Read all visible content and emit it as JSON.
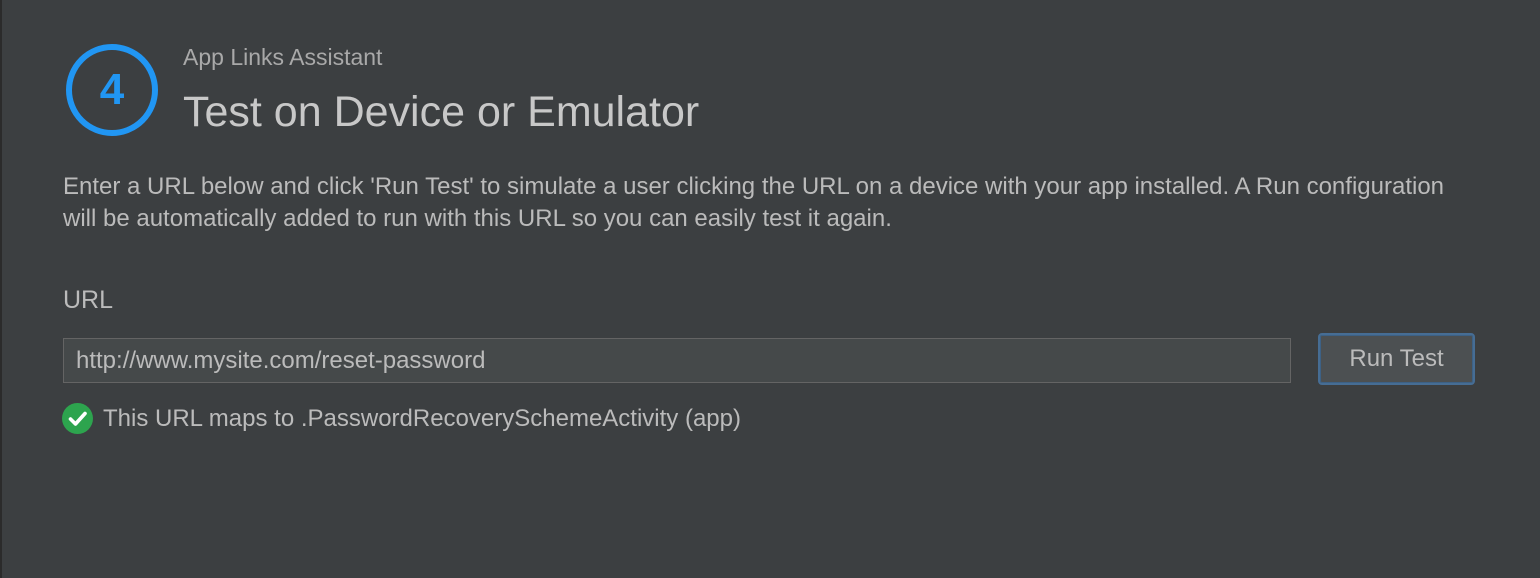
{
  "header": {
    "step_number": "4",
    "assistant_name": "App Links Assistant",
    "title": "Test on Device or Emulator"
  },
  "description": "Enter a URL below and click 'Run Test' to simulate a user clicking the URL on a device with your app installed. A Run configuration will be automatically added to run with this URL so you can easily test it again.",
  "url_field": {
    "label": "URL",
    "value": "http://www.mysite.com/reset-password"
  },
  "run_button": {
    "label": "Run Test"
  },
  "result": {
    "icon": "check-circle-icon",
    "status": "success",
    "text": "This URL maps to .PasswordRecoverySchemeActivity (app)"
  },
  "colors": {
    "background": "#3c3f41",
    "accent": "#2196f3",
    "success": "#2da44e",
    "text": "#bbbbbb"
  }
}
